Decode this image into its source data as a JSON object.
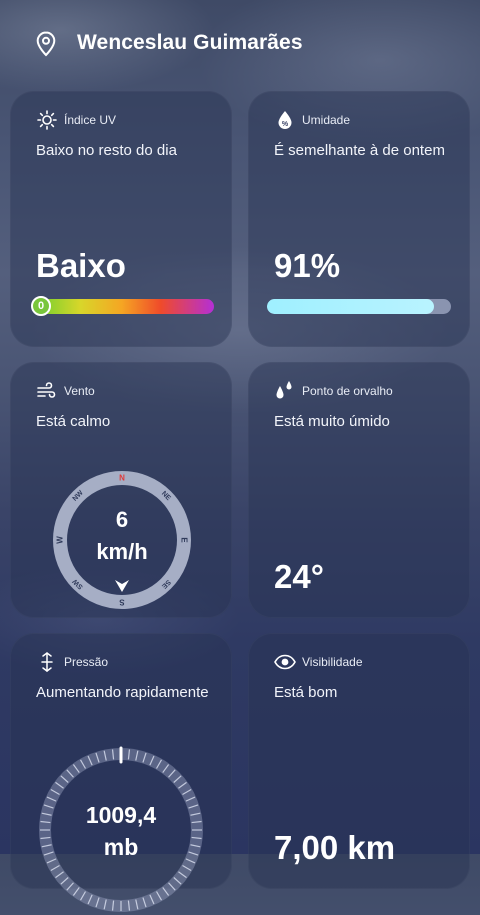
{
  "header": {
    "city": "Wenceslau Guimarães",
    "icon": "location-pin-icon"
  },
  "cards": {
    "uv": {
      "title": "Índice UV",
      "icon": "sun-icon",
      "description": "Baixo no resto do dia",
      "value": "Baixo",
      "index": "0",
      "scale_colors": [
        "#6fcf2f",
        "#d8d62a",
        "#f5a623",
        "#ef4b2a",
        "#b42fd6"
      ]
    },
    "humidity": {
      "title": "Umidade",
      "icon": "humidity-drop-icon",
      "description": "É semelhante à de ontem",
      "value": "91%",
      "fill_fraction": 0.91
    },
    "wind": {
      "title": "Vento",
      "icon": "wind-icon",
      "description": "Está calmo",
      "speed": "6",
      "unit": "km/h",
      "directions": [
        "N",
        "NE",
        "E",
        "SE",
        "S",
        "SW",
        "W",
        "NW"
      ],
      "heading": "S"
    },
    "dew": {
      "title": "Ponto de orvalho",
      "icon": "dew-drops-icon",
      "description": "Está muito úmido",
      "value": "24°"
    },
    "pressure": {
      "title": "Pressão",
      "icon": "pressure-icon",
      "description": "Aumentando rapidamente",
      "value": "1009,4",
      "unit": "mb"
    },
    "visibility": {
      "title": "Visibilidade",
      "icon": "eye-icon",
      "description": "Está bom",
      "value": "7,00 km"
    }
  }
}
